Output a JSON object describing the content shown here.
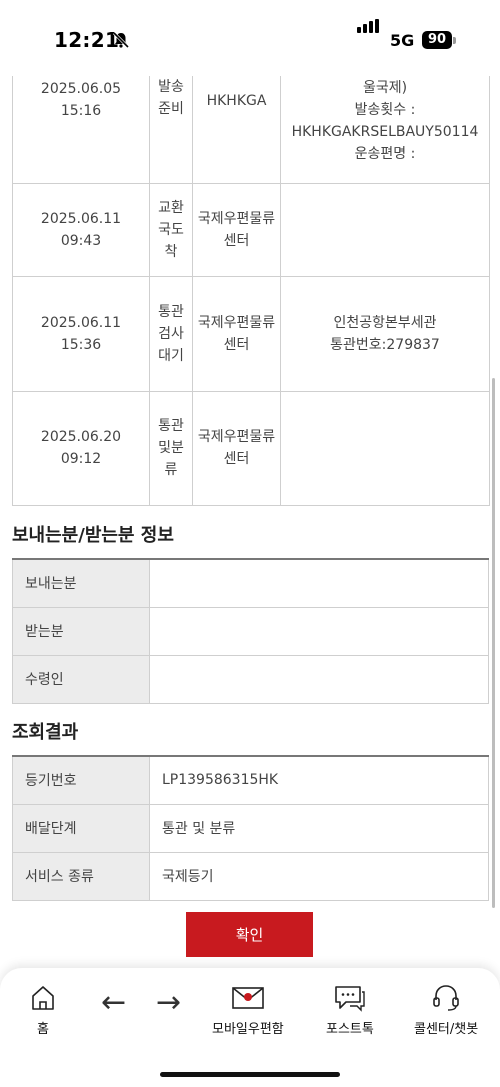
{
  "status_bar": {
    "time": "12:21",
    "network": "5G",
    "battery": "90"
  },
  "tracking_rows": [
    {
      "date": "2025.06.05\n15:16",
      "step": "발송준비",
      "location": "HKHKGA",
      "detail": "울국제)\n발송횟수 :\nHKHKGAKRSELBAUY50114\n운송편명 :"
    },
    {
      "date": "2025.06.11\n09:43",
      "step": "교환국도착",
      "location": "국제우편물류센터",
      "detail": ""
    },
    {
      "date": "2025.06.11\n15:36",
      "step": "통관검사대기",
      "location": "국제우편물류센터",
      "detail": "인천공항본부세관\n통관번호:279837"
    },
    {
      "date": "2025.06.20\n09:12",
      "step": "통관및분류",
      "location": "국제우편물류센터",
      "detail": ""
    }
  ],
  "sender_section": {
    "title": "보내는분/받는분 정보",
    "rows": [
      {
        "label": "보내는분",
        "value": ""
      },
      {
        "label": "받는분",
        "value": ""
      },
      {
        "label": "수령인",
        "value": ""
      }
    ]
  },
  "result_section": {
    "title": "조회결과",
    "rows": [
      {
        "label": "등기번호",
        "value": "LP139586315HK"
      },
      {
        "label": "배달단계",
        "value": "통관 및 분류"
      },
      {
        "label": "서비스 종류",
        "value": "국제등기"
      }
    ]
  },
  "confirm_label": "확인",
  "bottom_nav": {
    "home": "홈",
    "back": "←",
    "forward": "→",
    "mobile_post": "모바일우편함",
    "post_talk": "포스트톡",
    "call_center": "콜센터/챗봇"
  },
  "colors": {
    "accent": "#c81a1f",
    "label_bg": "#ececec",
    "border": "#cfcfcf"
  }
}
